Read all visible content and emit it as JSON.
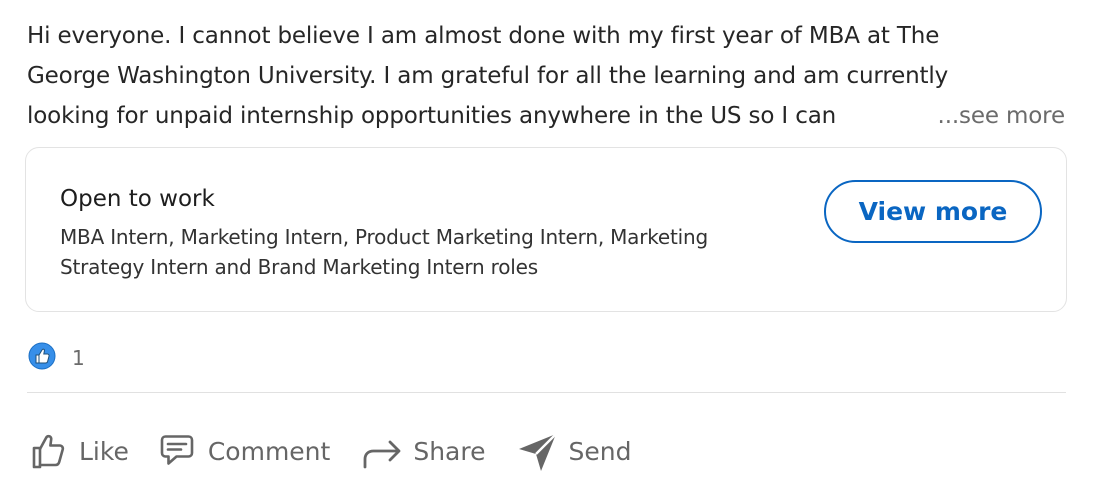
{
  "post": {
    "lines": [
      "Hi everyone. I cannot believe I am almost done with my first year of MBA at The",
      "George Washington University. I am grateful for all the learning and am currently",
      "looking for unpaid internship opportunities anywhere in the US so I can"
    ],
    "see_more_label": "...see more"
  },
  "open_to_work": {
    "title": "Open to work",
    "description": "MBA Intern, Marketing Intern, Product Marketing Intern, Marketing Strategy Intern and Brand Marketing Intern roles",
    "button_label": "View more"
  },
  "reactions": {
    "icon": "like-reaction-icon",
    "count": "1"
  },
  "actions": {
    "like_label": "Like",
    "comment_label": "Comment",
    "share_label": "Share",
    "send_label": "Send"
  },
  "colors": {
    "accent": "#0a66c2",
    "muted": "#666666"
  }
}
